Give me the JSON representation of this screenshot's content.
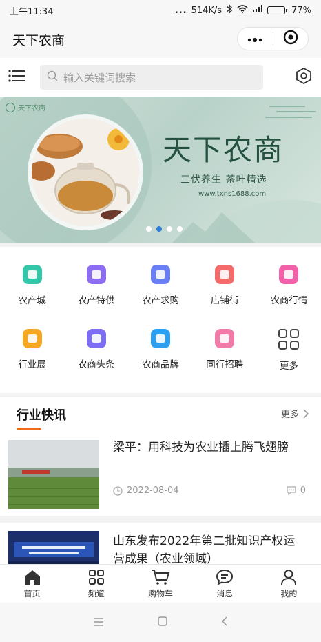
{
  "status_bar": {
    "time": "上午11:34",
    "signal_dots": "...",
    "speed": "514K/s",
    "battery": "77%",
    "battery_level": 0.77
  },
  "titlebar": {
    "title": "天下农商"
  },
  "search": {
    "placeholder": "输入关键词搜索"
  },
  "banner": {
    "brand_small": "天下农商",
    "title": "天下农商",
    "subtitle": "三伏养生   茶叶精选",
    "url": "www.txns1688.com",
    "active_slide": 2,
    "slide_count": 4
  },
  "menu": {
    "rows": [
      [
        {
          "label": "农产城",
          "color": "#34c6a8"
        },
        {
          "label": "农产特供",
          "color": "#8c6cf0"
        },
        {
          "label": "农产求购",
          "color": "#6a7ff5"
        },
        {
          "label": "店铺街",
          "color": "#f46a6a"
        },
        {
          "label": "农商行情",
          "color": "#f160a8"
        }
      ],
      [
        {
          "label": "行业展",
          "color": "#f5a623"
        },
        {
          "label": "农商头条",
          "color": "#7c6df2"
        },
        {
          "label": "农商品牌",
          "color": "#2c9ff0"
        },
        {
          "label": "同行招聘",
          "color": "#f27aa8"
        },
        {
          "label": "更多",
          "color": "#444444"
        }
      ]
    ]
  },
  "news": {
    "title": "行业快讯",
    "more": "更多",
    "accent": "#f26b1d",
    "items": [
      {
        "title": "梁平：用科技为农业插上腾飞翅膀",
        "date": "2022-08-04",
        "comments": "0"
      },
      {
        "title": "山东发布2022年第二批知识产权运营成果（农业领域）"
      }
    ]
  },
  "tabbar": {
    "items": [
      {
        "label": "首页"
      },
      {
        "label": "频道"
      },
      {
        "label": "购物车"
      },
      {
        "label": "消息"
      },
      {
        "label": "我的"
      }
    ]
  }
}
